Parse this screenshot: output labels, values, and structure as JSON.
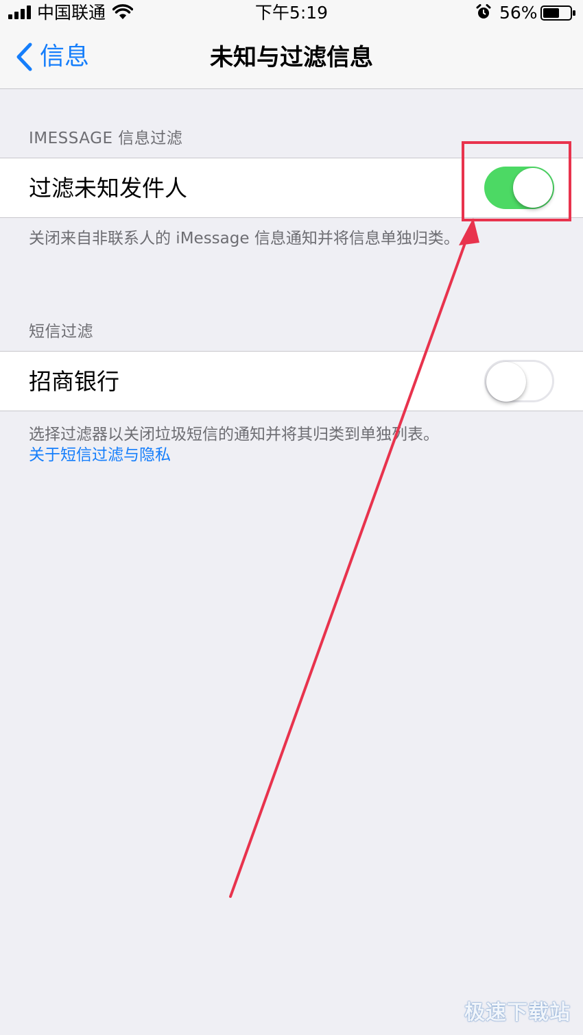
{
  "status_bar": {
    "carrier": "中国联通",
    "time": "下午5:19",
    "battery_percent": "56%",
    "icons": [
      "signal-icon",
      "wifi-icon",
      "alarm-icon",
      "battery-icon"
    ]
  },
  "nav": {
    "back_label": "信息",
    "title": "未知与过滤信息",
    "accent_color": "#157efb"
  },
  "sections": [
    {
      "header": "IMESSAGE 信息过滤",
      "cell_label": "过滤未知发件人",
      "toggle_on": true,
      "footer": "关闭来自非联系人的 iMessage 信息通知并将信息单独归类。"
    },
    {
      "header": "短信过滤",
      "cell_label": "招商银行",
      "toggle_on": false,
      "footer": "选择过滤器以关闭垃圾短信的通知并将其归类到单独列表。",
      "footer_link": "关于短信过滤与隐私"
    }
  ],
  "colors": {
    "toggle_on": "#4cd964",
    "background": "#efeff4",
    "annotation": "#e8334d"
  },
  "watermark": "极速下载站"
}
